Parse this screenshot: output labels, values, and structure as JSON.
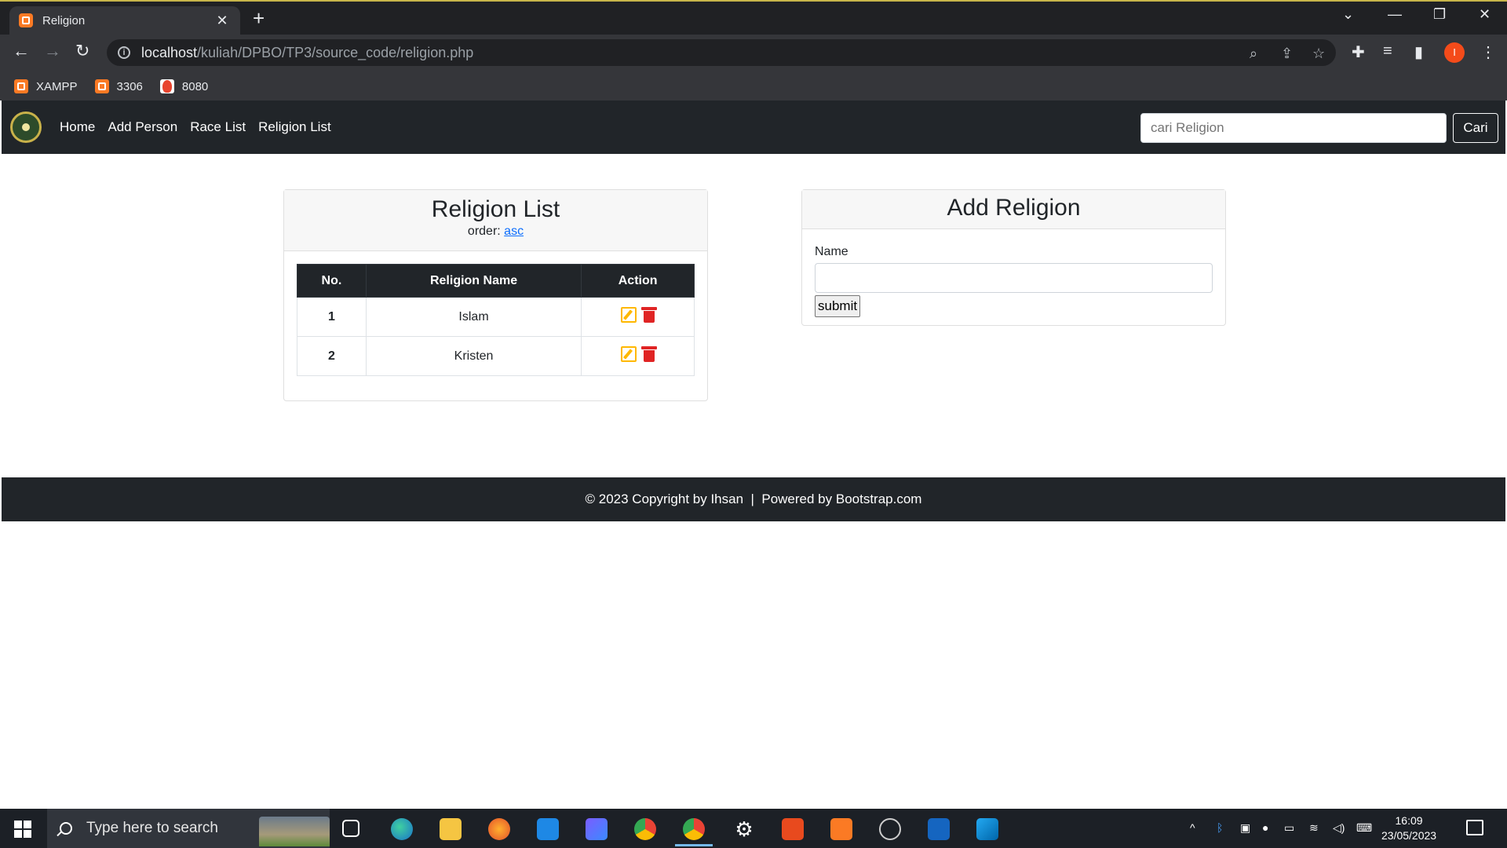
{
  "browser": {
    "tab_title": "Religion",
    "tab_close": "✕",
    "new_tab": "+",
    "url_host": "localhost",
    "url_path": "/kuliah/DPBO/TP3/source_code/religion.php",
    "bookmarks": [
      {
        "label": "XAMPP"
      },
      {
        "label": "3306"
      },
      {
        "label": "8080"
      }
    ],
    "profile_initial": "I"
  },
  "navbar": {
    "links": [
      "Home",
      "Add Person",
      "Race List",
      "Religion List"
    ],
    "search_placeholder": "cari Religion",
    "search_button": "Cari"
  },
  "religion_list": {
    "title": "Religion List",
    "order_label": "order:",
    "order_value": "asc",
    "columns": [
      "No.",
      "Religion Name",
      "Action"
    ],
    "rows": [
      {
        "no": "1",
        "name": "Islam"
      },
      {
        "no": "2",
        "name": "Kristen"
      }
    ]
  },
  "add_religion": {
    "title": "Add Religion",
    "name_label": "Name",
    "submit_label": "submit"
  },
  "footer": {
    "text": "© 2023 Copyright by Ihsan  |  Powered by Bootstrap.com"
  },
  "taskbar": {
    "search_placeholder": "Type here to search",
    "time": "16:09",
    "date": "23/05/2023"
  }
}
